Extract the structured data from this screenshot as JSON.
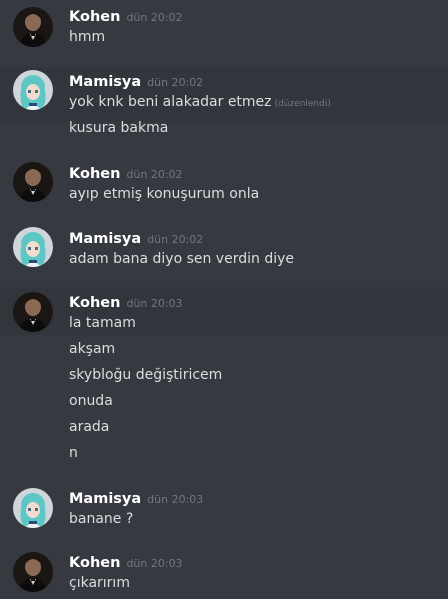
{
  "groups": [
    {
      "author": "Kohen",
      "avatar": "kohen",
      "timestamp": "dün 20:02",
      "messages": [
        {
          "text": "hmm"
        }
      ]
    },
    {
      "author": "Mamisya",
      "avatar": "mamisya",
      "timestamp": "dün 20:02",
      "messages": [
        {
          "text": "yok knk beni alakadar etmez",
          "edited": "(düzenlendi)"
        },
        {
          "text": "kusura bakma"
        }
      ]
    },
    {
      "author": "Kohen",
      "avatar": "kohen",
      "timestamp": "dün 20:02",
      "messages": [
        {
          "text": "ayıp etmiş konuşurum onla"
        }
      ]
    },
    {
      "author": "Mamisya",
      "avatar": "mamisya",
      "timestamp": "dün 20:02",
      "messages": [
        {
          "text": "adam bana diyo sen verdin diye"
        }
      ]
    },
    {
      "author": "Kohen",
      "avatar": "kohen",
      "timestamp": "dün 20:03",
      "messages": [
        {
          "text": "la tamam"
        },
        {
          "text": "akşam"
        },
        {
          "text": "skybloğu değiştiricem"
        },
        {
          "text": "onuda"
        },
        {
          "text": "arada"
        },
        {
          "text": "n"
        }
      ]
    },
    {
      "author": "Mamisya",
      "avatar": "mamisya",
      "timestamp": "dün 20:03",
      "messages": [
        {
          "text": "banane ?"
        }
      ]
    },
    {
      "author": "Kohen",
      "avatar": "kohen",
      "timestamp": "dün 20:03",
      "messages": [
        {
          "text": "çıkarırım"
        }
      ]
    }
  ],
  "colors": {
    "background": "#36393f",
    "highlight_row": "#32353b",
    "username": "#ffffff",
    "timestamp": "#72767d",
    "message_text": "#dcddde"
  }
}
